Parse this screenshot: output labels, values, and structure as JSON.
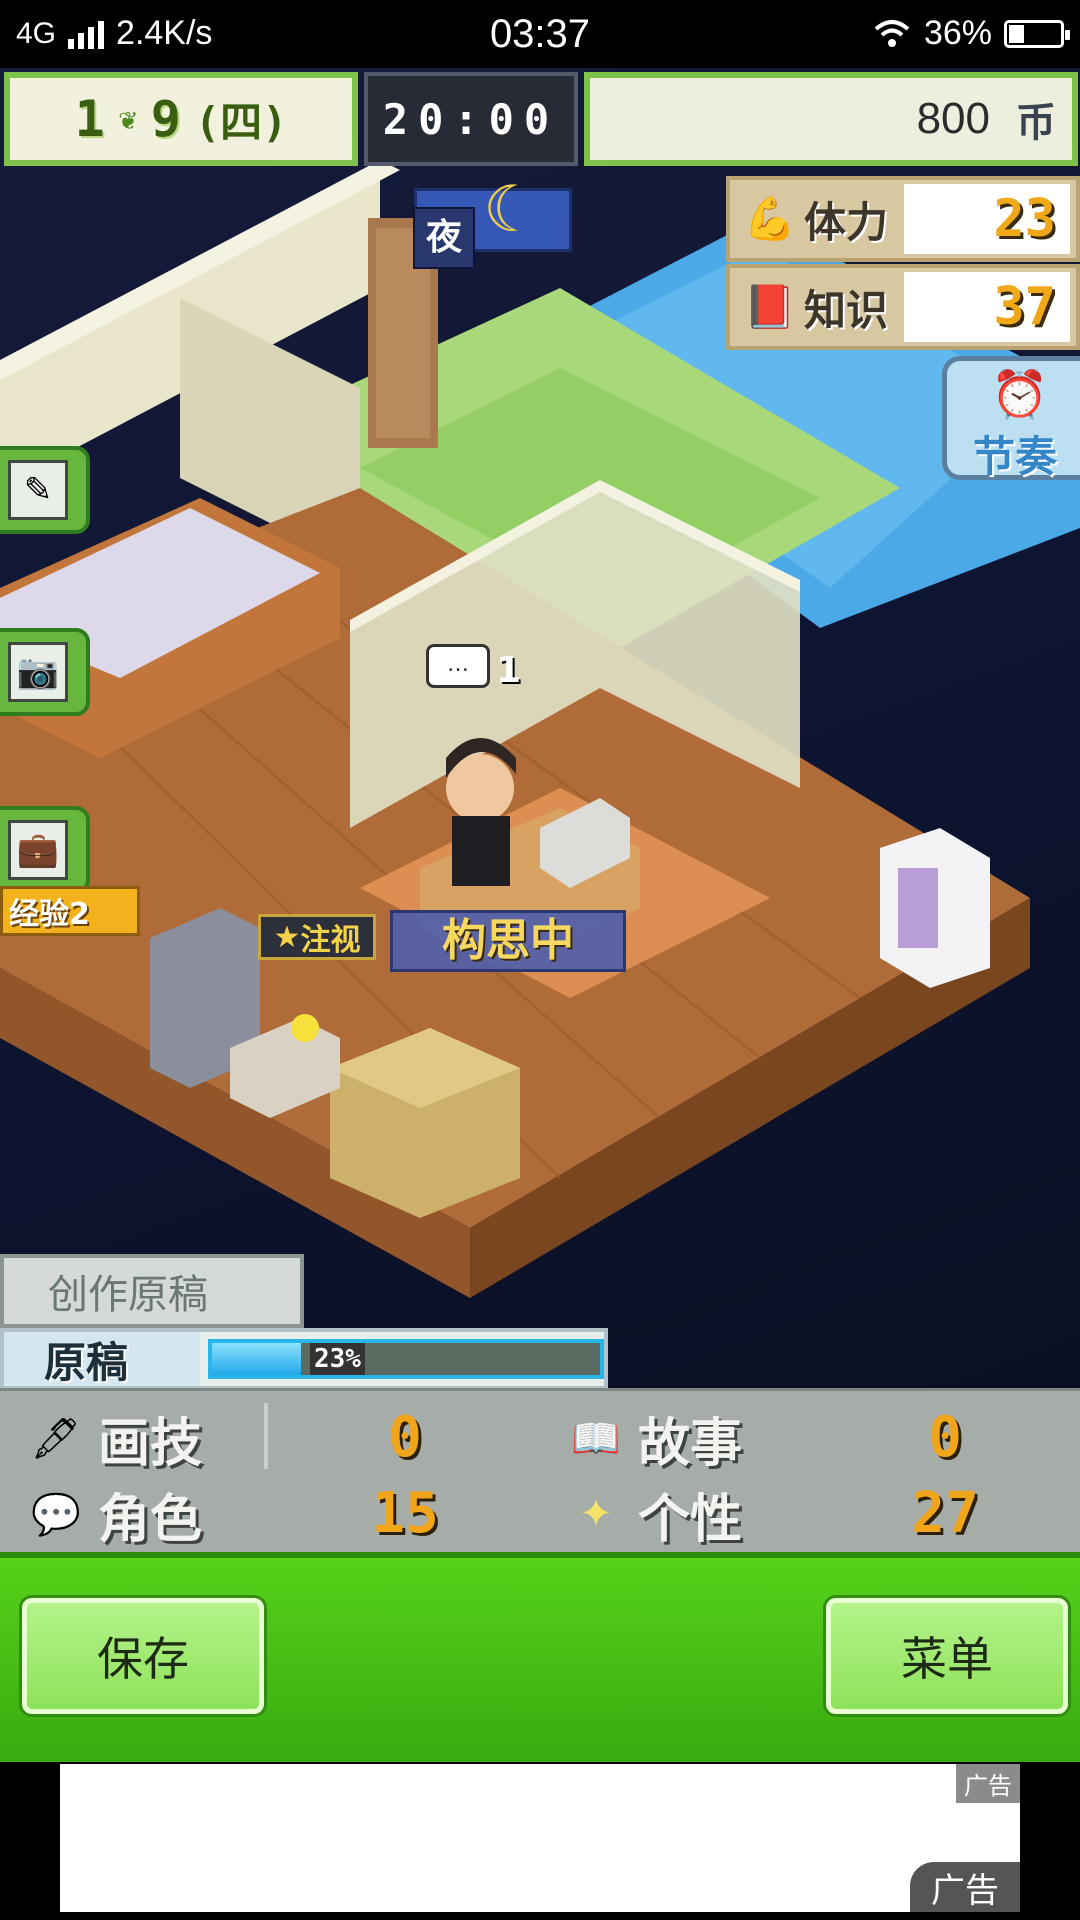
{
  "status_bar": {
    "network": "4G",
    "speed": "2.4K/s",
    "time": "03:37",
    "battery": "36%",
    "battery_level": 0.36
  },
  "hud": {
    "month": "1",
    "day": "9",
    "weekday": "(四)",
    "clock": "20:00",
    "money": "800",
    "currency": "币",
    "period": "夜"
  },
  "stats": [
    {
      "label": "体力",
      "value": "23",
      "icon": "muscle-icon"
    },
    {
      "label": "知识",
      "value": "37",
      "icon": "book-icon"
    }
  ],
  "rhythm_button": {
    "label": "节奏",
    "icon": "alarm-clock-icon"
  },
  "side_buttons": [
    {
      "name": "edit-button",
      "icon": "notepad-pen-icon"
    },
    {
      "name": "camera-button",
      "icon": "camera-icon"
    },
    {
      "name": "briefcase-button",
      "icon": "briefcase-icon"
    }
  ],
  "tag_badge": "经验2",
  "scene": {
    "bubble_count": "1",
    "attention_label": "注视",
    "thinking_label": "构思中"
  },
  "work": {
    "title": "创作原稿",
    "label": "原稿",
    "progress_text": "23%",
    "progress": 0.23
  },
  "skills": [
    {
      "label": "画技",
      "value": "0",
      "icon": "pen-ink-icon"
    },
    {
      "label": "故事",
      "value": "0",
      "icon": "open-book-icon"
    },
    {
      "label": "角色",
      "value": "15",
      "icon": "character-icon"
    },
    {
      "label": "个性",
      "value": "27",
      "icon": "sparkle-icon"
    }
  ],
  "buttons": {
    "save": "保存",
    "menu": "菜单"
  },
  "ad": {
    "tag": "广告",
    "corner": "广告"
  }
}
